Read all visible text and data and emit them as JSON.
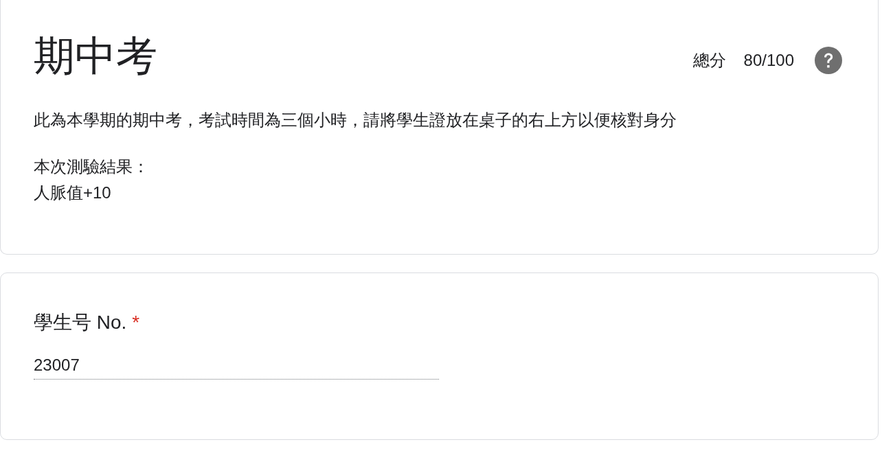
{
  "header": {
    "title": "期中考",
    "score_label": "總分",
    "score": "80/100",
    "description": "此為本學期的期中考，考試時間為三個小時，請將學生證放在桌子的右上方以便核對身分",
    "result_lines": [
      "本次測驗結果：",
      "人脈值+10"
    ]
  },
  "question": {
    "label": "學生号 No.",
    "required_mark": "*",
    "value": "23007"
  }
}
